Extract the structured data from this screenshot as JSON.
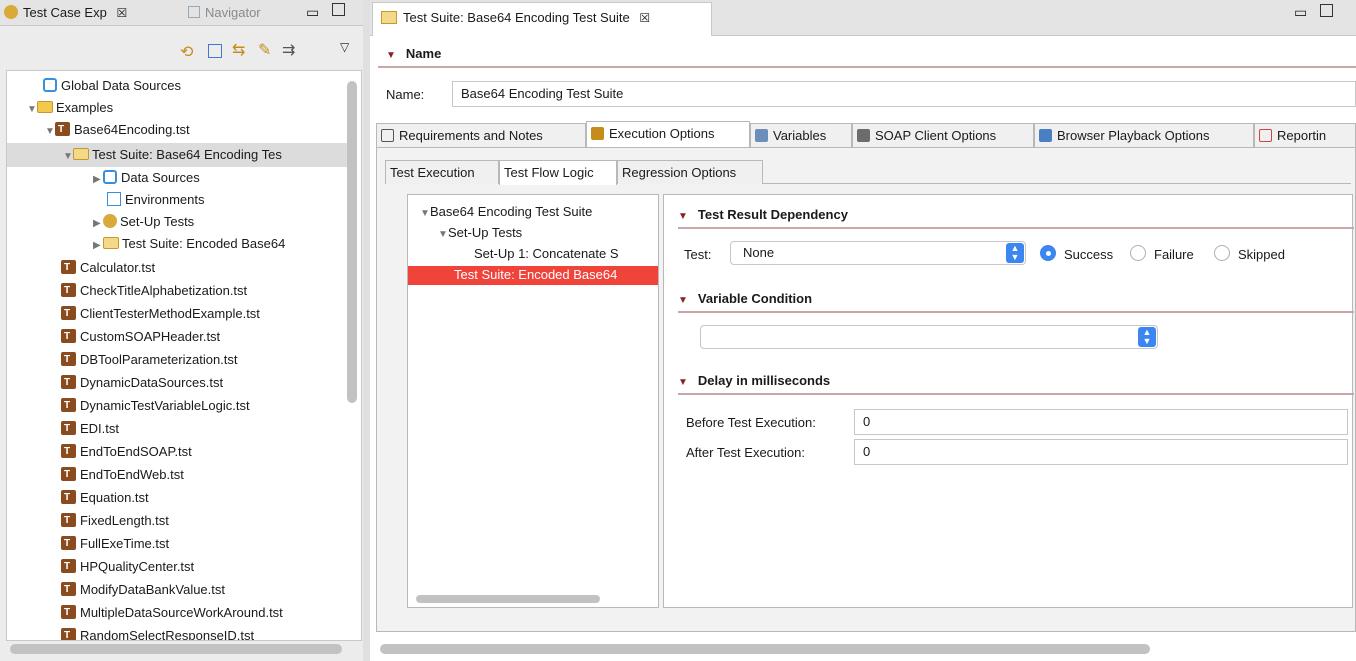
{
  "left_panel": {
    "tabs": [
      {
        "label": "Test Case Exp",
        "close": "☒"
      },
      {
        "label": "Navigator"
      }
    ],
    "tree": [
      {
        "label": "Global Data Sources",
        "icon": "data-sources-icon"
      },
      {
        "label": "Examples",
        "icon": "folder-icon"
      },
      {
        "label": "Base64Encoding.tst",
        "icon": "test-file-icon"
      },
      {
        "label": "Test Suite: Base64 Encoding Tes",
        "icon": "test-suite-icon"
      },
      {
        "label": "Data Sources",
        "icon": "data-sources-icon"
      },
      {
        "label": "Environments",
        "icon": "environments-icon"
      },
      {
        "label": "Set-Up Tests",
        "icon": "setup-tests-icon"
      },
      {
        "label": "Test Suite: Encoded Base64",
        "icon": "test-suite-icon"
      },
      {
        "label": "Calculator.tst"
      },
      {
        "label": "CheckTitleAlphabetization.tst"
      },
      {
        "label": "ClientTesterMethodExample.tst"
      },
      {
        "label": "CustomSOAPHeader.tst"
      },
      {
        "label": "DBToolParameterization.tst"
      },
      {
        "label": "DynamicDataSources.tst"
      },
      {
        "label": "DynamicTestVariableLogic.tst"
      },
      {
        "label": "EDI.tst"
      },
      {
        "label": "EndToEndSOAP.tst"
      },
      {
        "label": "EndToEndWeb.tst"
      },
      {
        "label": "Equation.tst"
      },
      {
        "label": "FixedLength.tst"
      },
      {
        "label": "FullExeTime.tst"
      },
      {
        "label": "HPQualityCenter.tst"
      },
      {
        "label": "ModifyDataBankValue.tst"
      },
      {
        "label": "MultipleDataSourceWorkAround.tst"
      },
      {
        "label": "RandomSelectResponseID.tst"
      }
    ]
  },
  "editor": {
    "tab_title": "Test Suite: Base64 Encoding Test Suite",
    "name_section": "Name",
    "name_label": "Name:",
    "name_value": "Base64 Encoding Test Suite",
    "main_tabs": [
      "Requirements and Notes",
      "Execution Options",
      "Variables",
      "SOAP Client Options",
      "Browser Playback Options",
      "Reportin"
    ],
    "sub_tabs": [
      "Test Execution",
      "Test Flow Logic",
      "Regression Options"
    ],
    "flow_tree": [
      "Base64 Encoding Test Suite",
      "Set-Up Tests",
      "Set-Up 1: Concatenate S",
      "Test Suite: Encoded Base64"
    ],
    "dependency": {
      "title": "Test Result Dependency",
      "test_label": "Test:",
      "test_value": "None",
      "options": [
        "Success",
        "Failure",
        "Skipped"
      ],
      "selected": "Success"
    },
    "variable_condition": {
      "title": "Variable Condition",
      "value": ""
    },
    "delay": {
      "title": "Delay in milliseconds",
      "before_label": "Before Test Execution:",
      "before_value": "0",
      "after_label": "After Test Execution:",
      "after_value": "0"
    }
  },
  "colors": {
    "selection": "#dcdcdc",
    "flow_selected": "#f0433a",
    "accent": "#3b86f0",
    "section_arrow": "#8a2020"
  }
}
